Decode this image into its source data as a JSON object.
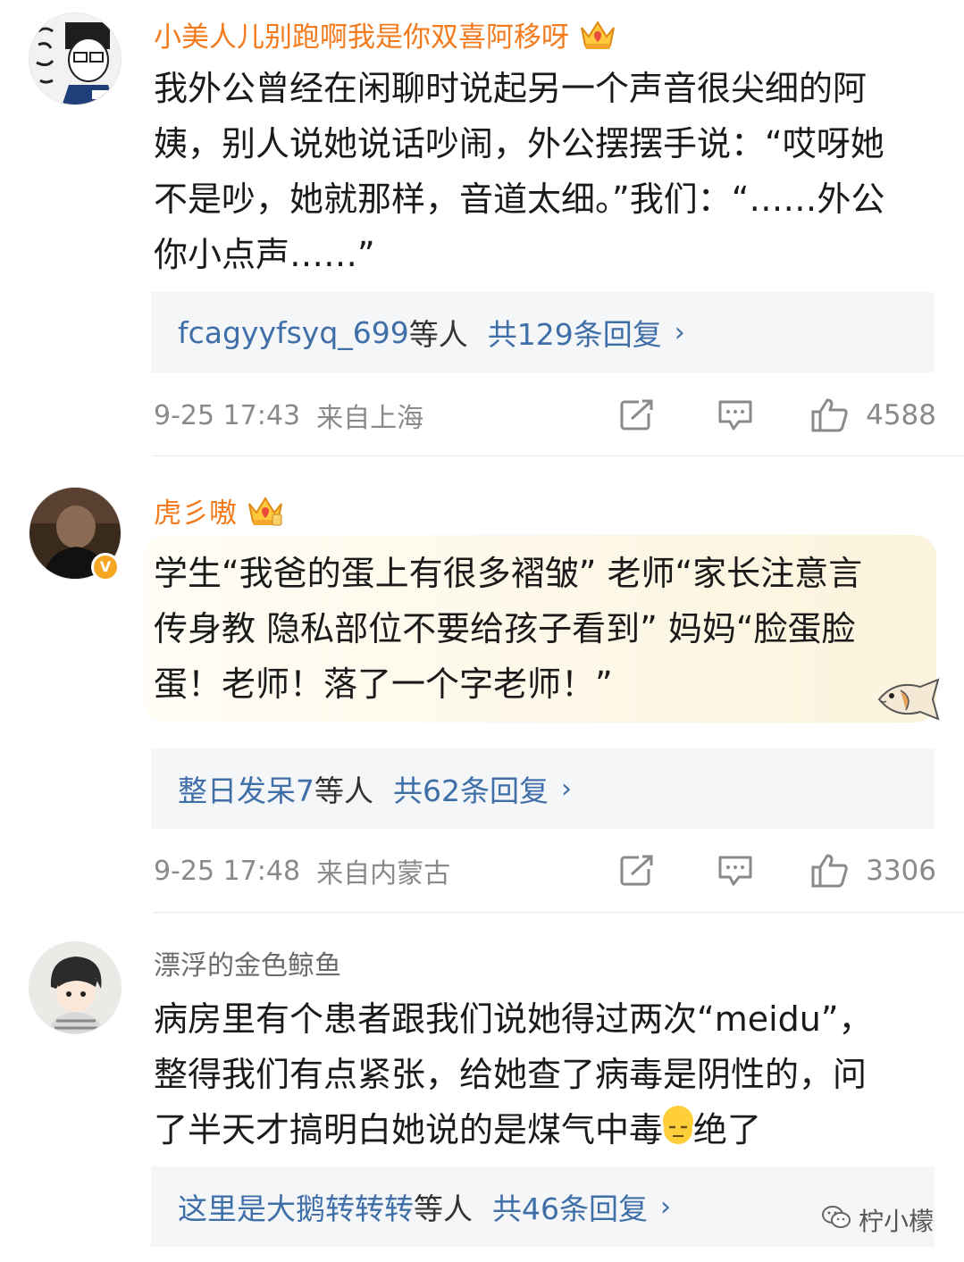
{
  "comments": [
    {
      "username": "小美人儿别跑啊我是你双喜阿移呀",
      "avatar_icon": "avatar-sketch-glasses",
      "badge_icon": "vip-crown-icon",
      "text_lines": [
        "我外公曾经在闲聊时说起另一个声音很尖细的阿",
        "姨，别人说她说话吵闹，外公摆摆手说：“哎呀她",
        "不是吵，她就那样，音道太细。”我们：“……外公",
        "你小点声……”"
      ],
      "reply_names": "fcagyyfsyq_699",
      "reply_suffix": "等人",
      "reply_count": "共129条回复",
      "reply_chevron": "›",
      "time": "9-25 17:43",
      "location": "来自上海",
      "likes": "4588"
    },
    {
      "username": "虎彡嗷",
      "avatar_icon": "avatar-bald-man",
      "badge_icon": "vip-crown-icon",
      "verified_mark": "V",
      "text_lines": [
        "学生“我爸的蛋上有很多褶皱” 老师“家长注意言",
        "传身教 隐私部位不要给孩子看到” 妈妈“脸蛋脸",
        "蛋！老师！落了一个字老师！”"
      ],
      "bubble_icon": "fish-icon",
      "reply_names": "整日发呆7",
      "reply_suffix": "等人",
      "reply_count": "共62条回复",
      "reply_chevron": "›",
      "time": "9-25 17:48",
      "location": "来自内蒙古",
      "likes": "3306"
    },
    {
      "username": "漂浮的金色鲸鱼",
      "avatar_icon": "avatar-anime-boy",
      "text_lines": [
        "病房里有个患者跟我们说她得过两次“meidu”，",
        "整得我们有点紧张，给她查了病毒是阴性的，问",
        "了半天才搞明白她说的是煤气中毒",
        "绝了"
      ],
      "inline_emoji": "speechless-emoji",
      "reply_names": "这里是大鹅转转转",
      "reply_suffix": "等人",
      "reply_count": "共46条回复",
      "reply_chevron": "›"
    }
  ],
  "watermark": {
    "text": "柠小檬",
    "icon": "wechat-icon"
  },
  "colors": {
    "vip_name": "#f37b1d",
    "link_blue": "#3f6fa8",
    "meta_gray": "#8a8a8a",
    "reply_bg": "#f5f6f7"
  }
}
